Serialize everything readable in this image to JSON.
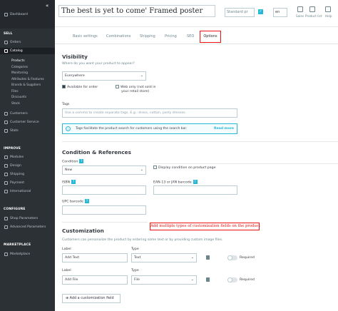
{
  "sidebar": {
    "dashboard": "Dashboard",
    "sell_section": "SELL",
    "orders": "Orders",
    "catalog": "Catalog",
    "catalog_sub": [
      "Products",
      "Categories",
      "Monitoring",
      "Attributes & Features",
      "Brands & Suppliers",
      "Files",
      "Discounts",
      "Stock"
    ],
    "customers": "Customers",
    "customer_service": "Customer Service",
    "stats": "Stats",
    "improve_section": "IMPROVE",
    "modules": "Modules",
    "design": "Design",
    "shipping": "Shipping",
    "payment": "Payment",
    "international": "International",
    "configure_section": "CONFIGURE",
    "shop_parameters": "Shop Parameters",
    "advanced_parameters": "Advanced Parameters",
    "marketplace_section": "MARKETPLACE",
    "marketplace": "Marketplace"
  },
  "header": {
    "product_name": "The best is yet to come' Framed poster",
    "product_type": "Standard pr",
    "language": "en",
    "sales_label": "Sales",
    "product_list_label": "Product list",
    "help_label": "Help"
  },
  "tabs": [
    "Basic settings",
    "Combinations",
    "Shipping",
    "Pricing",
    "SEO",
    "Options"
  ],
  "visibility": {
    "title": "Visibility",
    "subtitle": "Where do you want your product to appear?",
    "selected": "Everywhere",
    "available_for_order": "Available for order",
    "web_only_1": "Web only (not sold in",
    "web_only_2": "your retail store)"
  },
  "tags": {
    "label": "Tags",
    "placeholder": "Use a comma to create separate tags. E.g.: dress, cotton, party dresses.",
    "info": "Tags facilitate the product search for customers using the search bar.",
    "read_more": "Read more"
  },
  "condition": {
    "title": "Condition & References",
    "label": "Condition",
    "selected": "New",
    "display_condition": "Display condition on product page",
    "isbn": "ISBN",
    "ean": "EAN-13 or JAN barcode",
    "upc": "UPC barcode"
  },
  "annotation": "Add multiple types of customization fields on the product",
  "customization": {
    "title": "Customization",
    "subtitle": "Customers can personalize the product by entering some text or by providing custom image files.",
    "fields": [
      {
        "label_header": "Label",
        "type_header": "Type",
        "label_value": "Add Text",
        "type_value": "Text",
        "required": "Required"
      },
      {
        "label_header": "Label",
        "type_header": "Type",
        "label_value": "Add File",
        "type_value": "File",
        "required": "Required"
      }
    ],
    "add_button": "Add a customization field"
  }
}
